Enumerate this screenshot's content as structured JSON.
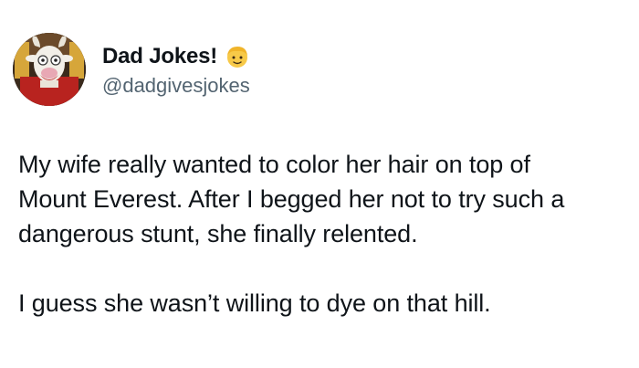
{
  "author": {
    "display_name": "Dad Jokes!",
    "handle": "@dadgivesjokes",
    "avatar_icon": "goat-avatar-icon",
    "badge_icon": "man-blond-emoji-icon"
  },
  "tweet": {
    "paragraph_1": "My wife really wanted to color her hair on top of\nMount Everest. After I begged her not to try such a\ndangerous stunt, she finally relented.",
    "paragraph_2": "I guess she wasn’t willing to dye on that hill."
  },
  "colors": {
    "text": "#0f1419",
    "handle": "#536471",
    "background": "#ffffff"
  }
}
